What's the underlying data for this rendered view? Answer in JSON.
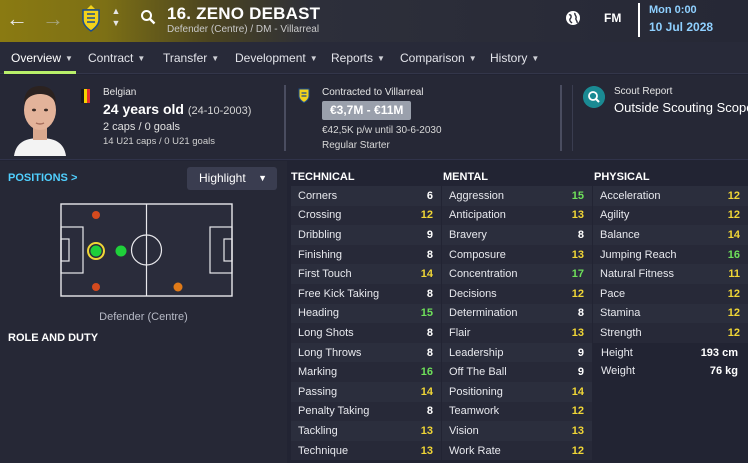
{
  "header": {
    "back_icon": "arrow-left-icon",
    "forward_icon": "arrow-right-icon",
    "player_name": "16. ZENO DEBAST",
    "player_sub": "Defender (Centre) / DM - Villarreal",
    "fm_logo": "FM",
    "time": "Mon 0:00",
    "date": "10 Jul 2028"
  },
  "tabs": [
    {
      "label": "Overview"
    },
    {
      "label": "Contract"
    },
    {
      "label": "Transfer"
    },
    {
      "label": "Development"
    },
    {
      "label": "Reports"
    },
    {
      "label": "Comparison"
    },
    {
      "label": "History"
    }
  ],
  "info": {
    "nationality": "Belgian",
    "age": "24 years old",
    "dob": "(24-10-2003)",
    "caps": "2 caps / 0 goals",
    "u21_caps": "14 U21 caps / 0 U21 goals",
    "contracted": "Contracted to Villarreal",
    "value": "€3,7M - €11M",
    "wage": "€42,5K p/w until 30-6-2030",
    "role_status": "Regular Starter",
    "scout_title": "Scout Report",
    "scout_value": "Outside Scouting Scope"
  },
  "positions": {
    "title": "POSITIONS",
    "title_chevron": ">",
    "highlight_label": "Highlight",
    "caption": "Defender (Centre)"
  },
  "role": {
    "title": "ROLE AND DUTY"
  },
  "columns": {
    "technical": "TECHNICAL",
    "mental": "MENTAL",
    "physical": "PHYSICAL"
  },
  "technical": [
    {
      "name": "Corners",
      "value": "6"
    },
    {
      "name": "Crossing",
      "value": "12"
    },
    {
      "name": "Dribbling",
      "value": "9"
    },
    {
      "name": "Finishing",
      "value": "8"
    },
    {
      "name": "First Touch",
      "value": "14"
    },
    {
      "name": "Free Kick Taking",
      "value": "8"
    },
    {
      "name": "Heading",
      "value": "15"
    },
    {
      "name": "Long Shots",
      "value": "8"
    },
    {
      "name": "Long Throws",
      "value": "8"
    },
    {
      "name": "Marking",
      "value": "16"
    },
    {
      "name": "Passing",
      "value": "14"
    },
    {
      "name": "Penalty Taking",
      "value": "8"
    },
    {
      "name": "Tackling",
      "value": "13"
    },
    {
      "name": "Technique",
      "value": "13"
    }
  ],
  "mental": [
    {
      "name": "Aggression",
      "value": "15"
    },
    {
      "name": "Anticipation",
      "value": "13"
    },
    {
      "name": "Bravery",
      "value": "8"
    },
    {
      "name": "Composure",
      "value": "13"
    },
    {
      "name": "Concentration",
      "value": "17"
    },
    {
      "name": "Decisions",
      "value": "12"
    },
    {
      "name": "Determination",
      "value": "8"
    },
    {
      "name": "Flair",
      "value": "13"
    },
    {
      "name": "Leadership",
      "value": "9"
    },
    {
      "name": "Off The Ball",
      "value": "9"
    },
    {
      "name": "Positioning",
      "value": "14"
    },
    {
      "name": "Teamwork",
      "value": "12"
    },
    {
      "name": "Vision",
      "value": "13"
    },
    {
      "name": "Work Rate",
      "value": "12"
    }
  ],
  "physical": [
    {
      "name": "Acceleration",
      "value": "12"
    },
    {
      "name": "Agility",
      "value": "12"
    },
    {
      "name": "Balance",
      "value": "14"
    },
    {
      "name": "Jumping Reach",
      "value": "16"
    },
    {
      "name": "Natural Fitness",
      "value": "11"
    },
    {
      "name": "Pace",
      "value": "12"
    },
    {
      "name": "Stamina",
      "value": "12"
    },
    {
      "name": "Strength",
      "value": "12"
    }
  ],
  "physical_extra": [
    {
      "name": "Height",
      "value": "193 cm"
    },
    {
      "name": "Weight",
      "value": "76 kg"
    }
  ],
  "colors": {
    "accent_green": "#b9f06a",
    "attr_high": "#6ee05a",
    "attr_mid": "#f0d636",
    "attr_low": "#ffffff",
    "position_natural": "#1fd03a",
    "position_unconvincing": "#d44a1e",
    "position_awkward": "#e07a18"
  }
}
